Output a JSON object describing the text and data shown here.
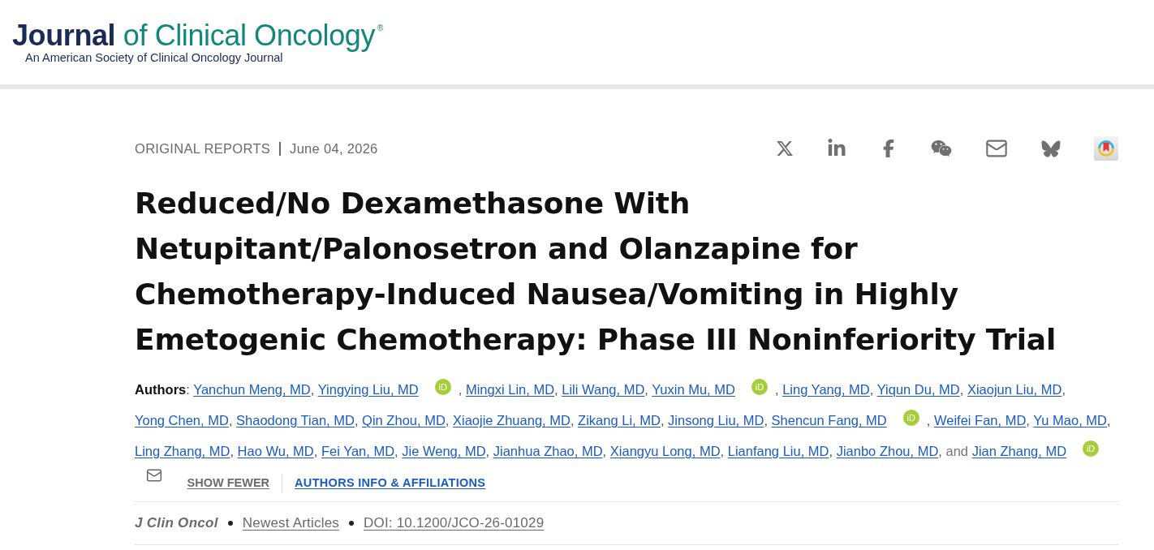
{
  "header": {
    "logo_title": "**Journal** of Clinical Oncology$^{®}$",
    "tagline": "An American Society of Clinical Oncology Journal"
  },
  "article": {
    "type": "ORIGINAL REPORTS",
    "date": "June 04, 2026",
    "title": "Reduced/No Dexamethasone With Netupitant/Palonosetron and Olanzapine for Chemotherapy-Induced Nausea/Vomiting in Highly Emetogenic Chemotherapy: Phase III Noninferiority Trial",
    "authors": {
      "label": "**Authors**:",
      "conjunction": "and",
      "list": [
        {
          "name": "Yanchun Meng, MD",
          "separator": ",",
          "email": false
        },
        {
          "name": "Yingying Liu, MD",
          "orcid": "iD",
          "separator": ",",
          "email": false
        },
        {
          "name": "Mingxi Lin, MD",
          "separator": ",",
          "email": false
        },
        {
          "name": "Lili Wang, MD",
          "separator": ",",
          "email": false
        },
        {
          "name": "Yuxin Mu, MD",
          "orcid": "iD",
          "separator": ",",
          "email": false
        },
        {
          "name": "Ling Yang, MD",
          "separator": ",",
          "email": false
        },
        {
          "name": "Yiqun Du, MD",
          "separator": ",",
          "email": false
        },
        {
          "name": "Xiaojun Liu, MD",
          "separator": ",",
          "email": false
        },
        {
          "name": "Yong Chen, MD",
          "separator": ",",
          "email": false
        },
        {
          "name": "Shaodong Tian, MD",
          "separator": ",",
          "email": false
        },
        {
          "name": "Qin Zhou, MD",
          "separator": ",",
          "email": false
        },
        {
          "name": "Xiaojie Zhuang, MD",
          "separator": ",",
          "email": false
        },
        {
          "name": "Zikang Li, MD",
          "separator": ",",
          "email": false
        },
        {
          "name": "Jinsong Liu, MD",
          "separator": ",",
          "email": false
        },
        {
          "name": "Shencun Fang, MD",
          "orcid": "iD",
          "separator": ",",
          "email": false
        },
        {
          "name": "Weifei Fan, MD",
          "separator": ",",
          "email": false
        },
        {
          "name": "Yu Mao, MD",
          "separator": ",",
          "email": false
        },
        {
          "name": "Ling Zhang, MD",
          "separator": ",",
          "email": false
        },
        {
          "name": "Hao Wu, MD",
          "separator": ",",
          "email": false
        },
        {
          "name": "Fei Yan, MD",
          "separator": ",",
          "email": false
        },
        {
          "name": "Jie Weng, MD",
          "separator": ",",
          "email": false
        },
        {
          "name": "Jianhua Zhao, MD",
          "separator": ",",
          "email": false
        },
        {
          "name": "Xiangyu Long, MD",
          "separator": ",",
          "email": false
        },
        {
          "name": "Lianfang Liu, MD",
          "separator": ",",
          "email": false
        },
        {
          "name": "Jianbo Zhou, MD",
          "separator": ",",
          "email": false
        },
        {
          "name": "Jian Zhang, MD",
          "orcid": "iD",
          "email": true
        }
      ]
    },
    "show_fewer": "SHOW FEWER",
    "affiliations_link": "AUTHORS INFO & AFFILIATIONS",
    "citation": {
      "journal": "J Clin Oncol",
      "section": "Newest Articles",
      "doi": "DOI: 10.1200/JCO-26-01029"
    }
  }
}
